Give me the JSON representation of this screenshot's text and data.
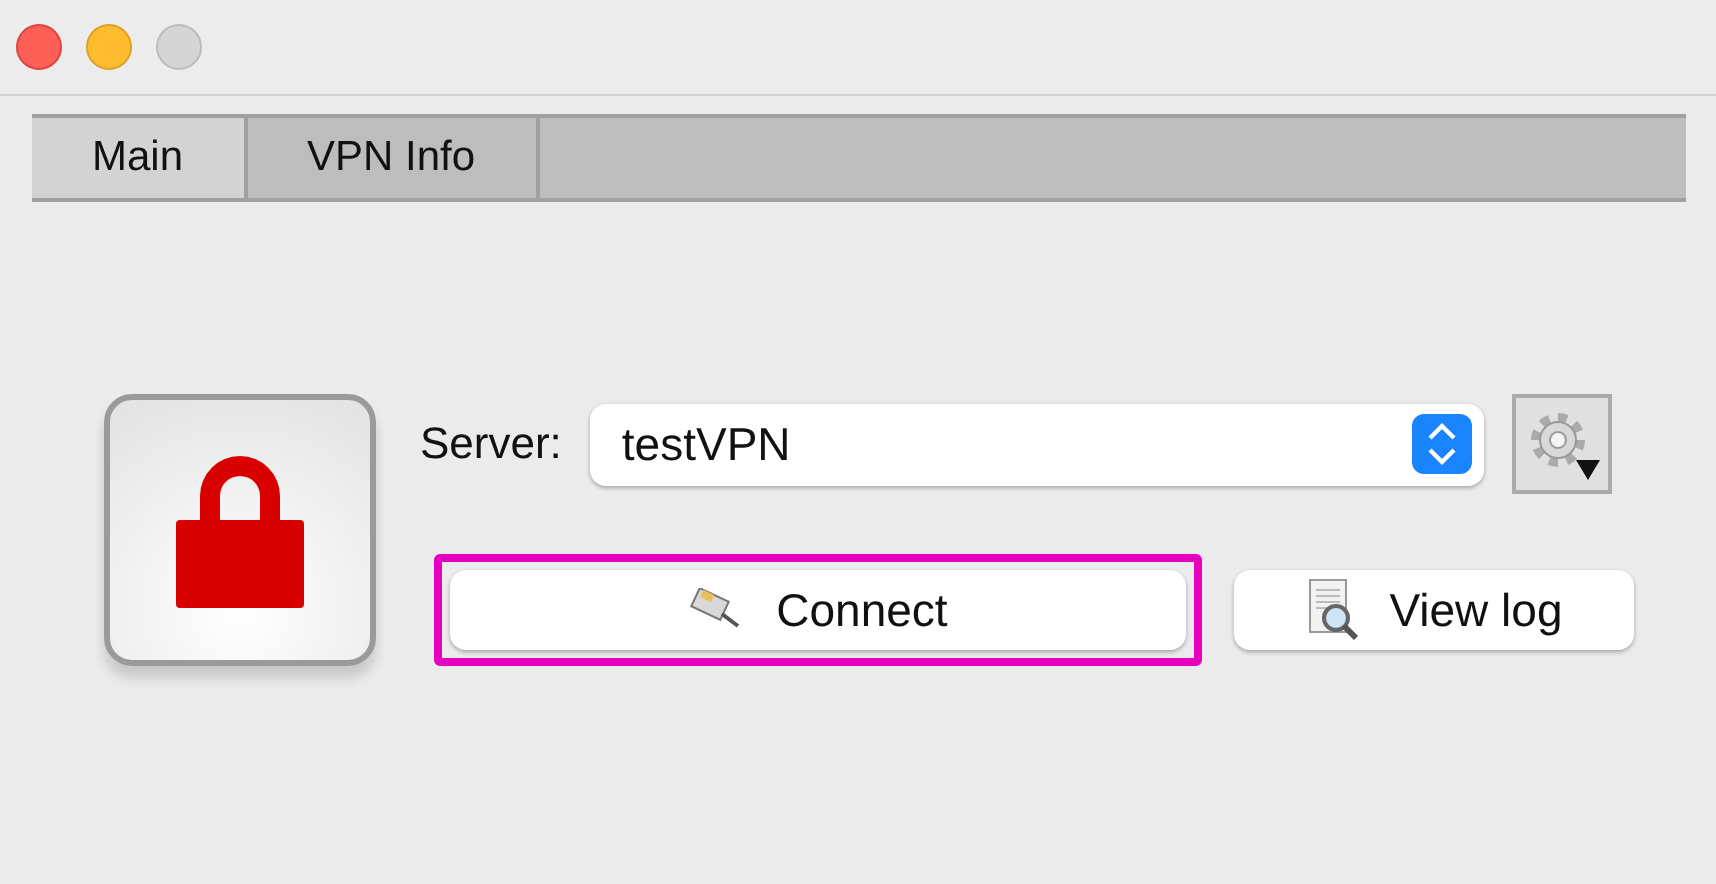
{
  "tabs": [
    {
      "label": "Main",
      "selected": true
    },
    {
      "label": "VPN Info",
      "selected": false
    }
  ],
  "server": {
    "label": "Server:",
    "value": "testVPN"
  },
  "buttons": [
    {
      "kind": "connect",
      "label": "Connect",
      "highlighted": true
    },
    {
      "kind": "log",
      "label": "View log",
      "highlighted": false
    }
  ]
}
